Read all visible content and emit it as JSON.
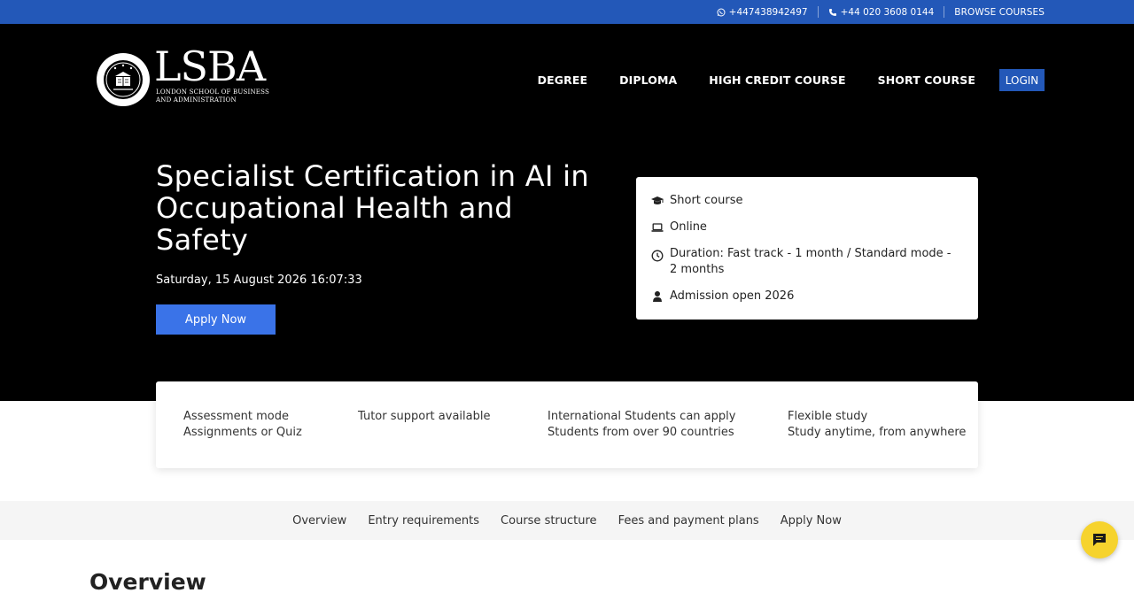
{
  "topbar": {
    "whatsapp": "+447438942497",
    "phone": "+44 020 3608 0144",
    "browse": "BROWSE COURSES"
  },
  "logo": {
    "word": "LSBA",
    "sub_line1": "LONDON SCHOOL OF BUSINESS",
    "sub_line2": "AND ADMINISTRATION"
  },
  "nav": {
    "items": [
      "DEGREE",
      "DIPLOMA",
      "HIGH CREDIT COURSE",
      "SHORT COURSE"
    ],
    "login": "LOGIN"
  },
  "hero": {
    "title": "Specialist Certification in AI in Occupational Health and Safety",
    "datetime": "Saturday, 15 August 2026 16:07:33",
    "apply": "Apply Now"
  },
  "info": {
    "course_type": "Short course",
    "mode": "Online",
    "duration": "Duration: Fast track - 1 month / Standard mode - 2 months",
    "admission": "Admission open 2026"
  },
  "features": [
    {
      "line1": "Assessment mode",
      "line2": "Assignments or Quiz"
    },
    {
      "line1": "Tutor support available",
      "line2": ""
    },
    {
      "line1": "International Students can apply",
      "line2": "Students from over 90 countries"
    },
    {
      "line1": "Flexible study",
      "line2": "Study anytime, from anywhere"
    }
  ],
  "tabs": [
    "Overview",
    "Entry requirements",
    "Course structure",
    "Fees and payment plans",
    "Apply Now"
  ],
  "section": {
    "title": "Overview"
  },
  "colors": {
    "topbar": "#2358b8",
    "apply": "#3a73e8",
    "chat": "#f6d32d"
  }
}
